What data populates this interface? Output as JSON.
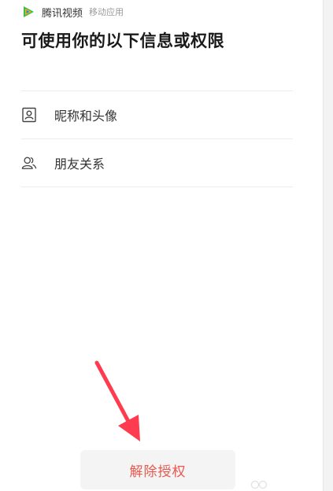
{
  "app": {
    "name": "腾讯视频",
    "type": "移动应用",
    "logo_icon": "tencent-video-play-logo",
    "logo_colors": [
      "#3fbf3f",
      "#f9a825",
      "#1e88e5"
    ]
  },
  "title": "可使用你的以下信息或权限",
  "permissions": [
    {
      "label": "昵称和头像",
      "icon": "profile-card-icon"
    },
    {
      "label": "朋友关系",
      "icon": "friends-icon"
    }
  ],
  "revoke_button": {
    "label": "解除授权",
    "color": "#e8584f"
  },
  "annotation_arrow_color": "#ff3b4f"
}
